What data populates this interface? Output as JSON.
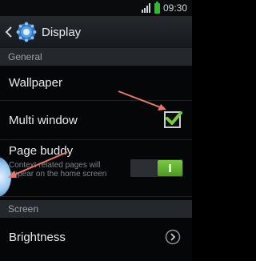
{
  "status_bar": {
    "time": "09:30"
  },
  "action_bar": {
    "title": "Display"
  },
  "sections": {
    "general_label": "General",
    "screen_label": "Screen"
  },
  "items": {
    "wallpaper": {
      "title": "Wallpaper"
    },
    "multi_window": {
      "title": "Multi window",
      "checked": true
    },
    "page_buddy": {
      "title": "Page buddy",
      "summary": "Context related pages will appear on the home screen",
      "enabled": true
    },
    "brightness": {
      "title": "Brightness"
    }
  },
  "colors": {
    "accent_green": "#7ac943",
    "annotation_arrow": "#e8776a"
  },
  "icons": {
    "back": "back-arrow-icon",
    "display": "display-settings-icon",
    "check": "check-icon",
    "chevron": "chevron-right-icon",
    "battery": "battery-icon",
    "signal": "signal-icon"
  }
}
